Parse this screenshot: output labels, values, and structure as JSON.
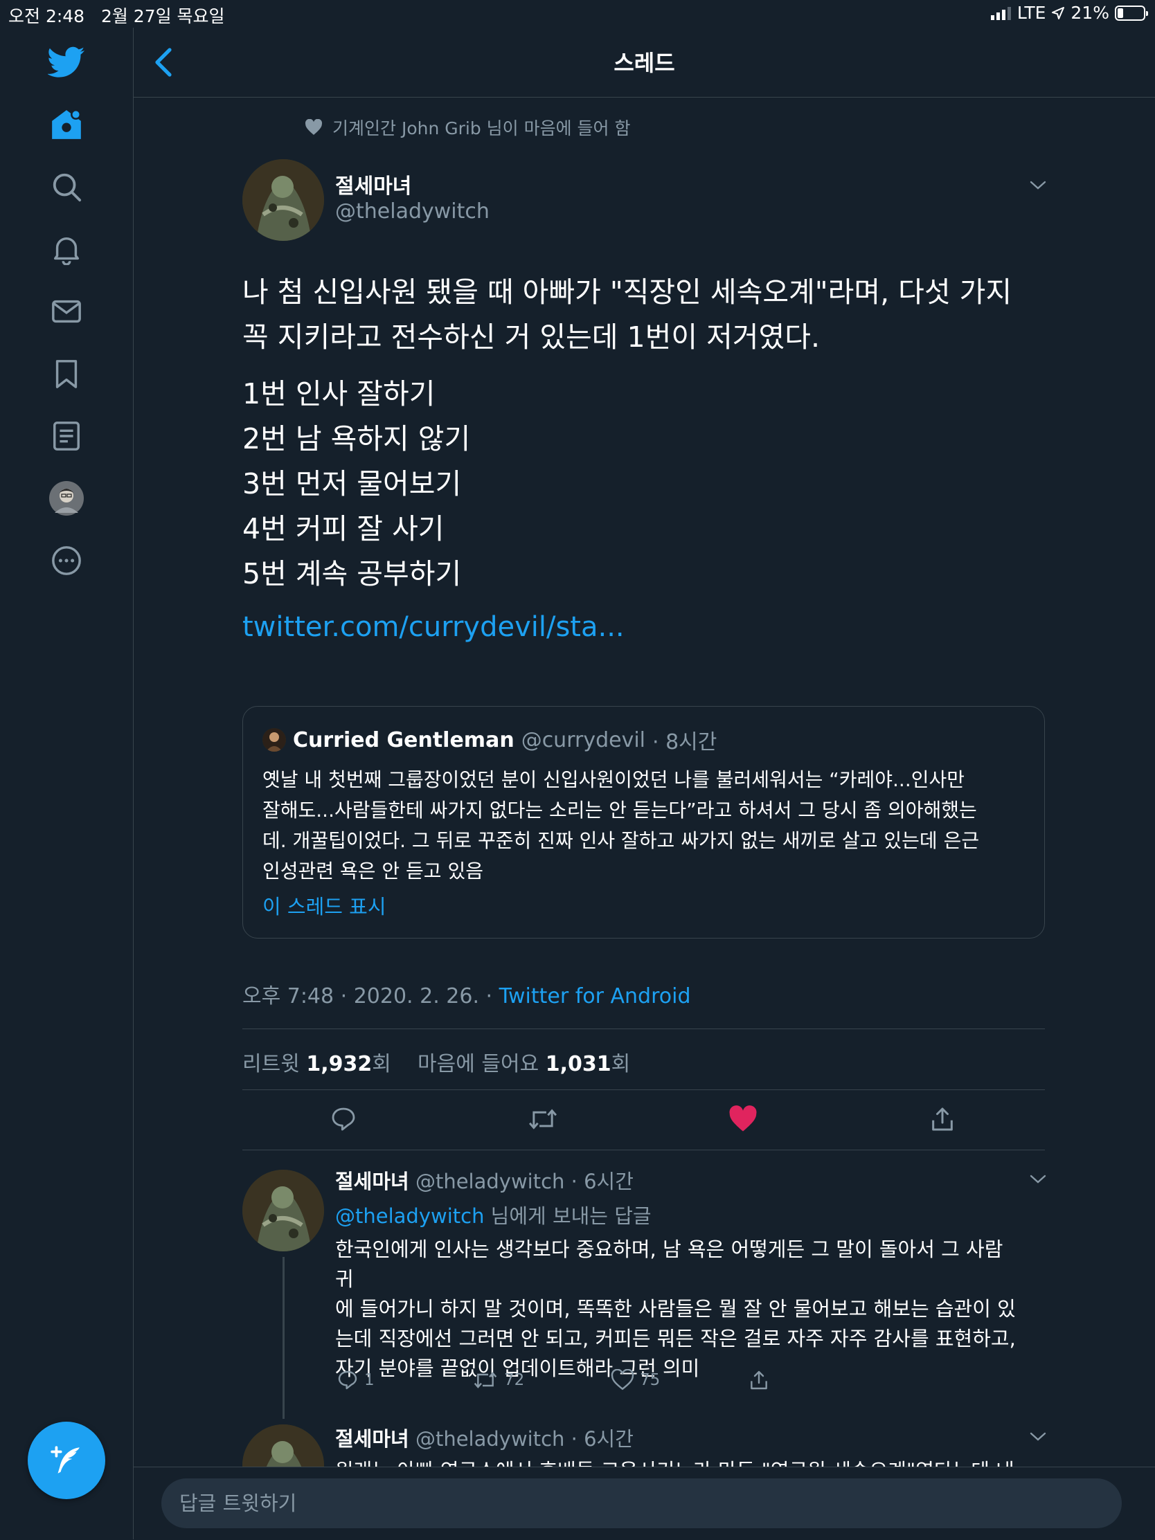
{
  "status_bar": {
    "time": "오전 2:48",
    "date": "2월 27일 목요일",
    "network": "LTE",
    "battery": "21%",
    "battery_level": 0.21
  },
  "sidebar": {
    "items": [
      {
        "icon": "twitter-logo-icon"
      },
      {
        "icon": "home-icon"
      },
      {
        "icon": "search-icon"
      },
      {
        "icon": "notifications-bell-icon"
      },
      {
        "icon": "messages-envelope-icon"
      },
      {
        "icon": "bookmark-icon"
      },
      {
        "icon": "lists-icon"
      },
      {
        "icon": "profile-avatar"
      },
      {
        "icon": "more-icon"
      }
    ]
  },
  "header": {
    "back_icon": "chevron-left-icon",
    "title": "스레드"
  },
  "tweet": {
    "liked_by": "기계인간 John Grib 님이 마음에 들어 함",
    "author_name": "절세마녀",
    "author_handle": "@theladywitch",
    "text_lines": [
      "나 첨 신입사원 됐을 때 아빠가 \"직장인 세속오계\"라며, 다섯 가지",
      "꼭 지키라고 전수하신 거 있는데 1번이 저거였다."
    ],
    "list": [
      "1번 인사 잘하기",
      "2번 남 욕하지 않기",
      "3번 먼저 물어보기",
      "4번 커피 잘 사기",
      "5번 계속 공부하기"
    ],
    "link": "twitter.com/currydevil/sta...",
    "quote": {
      "name": "Curried Gentleman",
      "handle": "@currydevil",
      "time": "· 8시간",
      "text_lines": [
        "옛날 내 첫번째 그룹장이었던 분이 신입사원이었던 나를 불러세워서는 “카레야...인사만",
        "잘해도...사람들한테 싸가지 없다는 소리는 안 듣는다”라고 하셔서 그 당시 좀 의아해했는",
        "데. 개꿀팁이었다. 그 뒤로 꾸준히 진짜 인사 잘하고 싸가지 없는 새끼로 살고 있는데 은근",
        "인성관련 욕은 안 듣고 있음"
      ],
      "show_thread": "이 스레드 표시"
    },
    "timestamp": "오후 7:48 · 2020. 2. 26. ·",
    "source": "Twitter for Android",
    "retweets_label": "리트윗",
    "retweets_count": "1,932",
    "retweets_unit": "회",
    "likes_label": "마음에 들어요",
    "likes_count": "1,031",
    "likes_unit": "회",
    "liked": true,
    "like_color": "#e0245e"
  },
  "replies": [
    {
      "author_name": "절세마녀",
      "author_handle": "@theladywitch",
      "time": "· 6시간",
      "replying_to_handle": "@theladywitch",
      "replying_to_suffix": " 님에게 보내는 답글",
      "text_lines": [
        "한국인에게 인사는 생각보다 중요하며, 남 욕은 어떻게든 그 말이 돌아서 그 사람 귀",
        "에 들어가니 하지 말 것이며, 똑똑한 사람들은 뭘 잘 안 물어보고 해보는 습관이 있",
        "는데 직장에선 그러면 안 되고, 커피든 뭐든 작은 걸로 자주 자주 감사를 표현하고,",
        "자기 분야를 끝없이 업데이트해라 그런 의미"
      ],
      "reply_count": "1",
      "retweet_count": "72",
      "like_count": "75"
    },
    {
      "author_name": "절세마녀",
      "author_handle": "@theladywitch",
      "time": "· 6시간",
      "text_partial": "원래는 아빠 연구소에서 후배들 교육시키느라 만든 \"연구원 세속오계\"였다는데 내"
    }
  ],
  "reply_bar": {
    "placeholder": "답글 트윗하기"
  },
  "compose_fab": {
    "icon": "compose-tweet-icon"
  },
  "colors": {
    "background": "#15202b",
    "accent": "#1da1f2",
    "muted": "#8899a6",
    "border": "#38444d",
    "like": "#e0245e"
  }
}
